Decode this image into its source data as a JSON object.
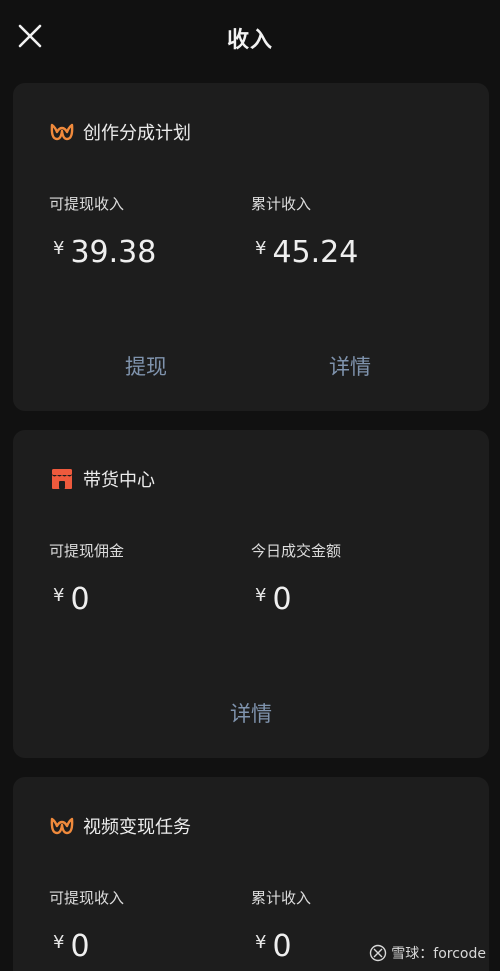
{
  "header": {
    "title": "收入"
  },
  "cards": [
    {
      "title": "创作分成计划",
      "icon": "orange-m-logo-icon",
      "left": {
        "label": "可提现收入",
        "currency": "¥",
        "value": "39.38"
      },
      "right": {
        "label": "累计收入",
        "currency": "¥",
        "value": "45.24"
      },
      "actions": [
        "提现",
        "详情"
      ]
    },
    {
      "title": "带货中心",
      "icon": "shop-icon",
      "left": {
        "label": "可提现佣金",
        "currency": "¥",
        "value": "0"
      },
      "right": {
        "label": "今日成交金额",
        "currency": "¥",
        "value": "0"
      },
      "actions": [
        "详情"
      ]
    },
    {
      "title": "视频变现任务",
      "icon": "orange-m-logo-icon",
      "left": {
        "label": "可提现收入",
        "currency": "¥",
        "value": "0"
      },
      "right": {
        "label": "累计收入",
        "currency": "¥",
        "value": "0"
      }
    }
  ],
  "watermark": {
    "text": "雪球：forcode"
  },
  "colors": {
    "background": "#111111",
    "card": "#1d1d1d",
    "accent_orange": "#f08a3c",
    "shop_red": "#ee5a3d",
    "link": "#7f93ad"
  }
}
